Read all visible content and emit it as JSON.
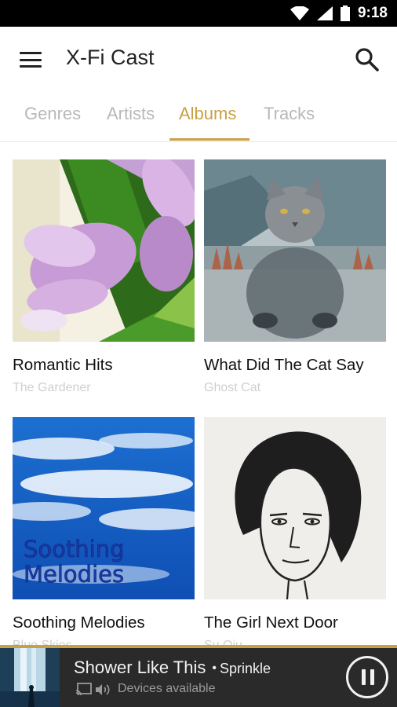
{
  "status_bar": {
    "time": "9:18"
  },
  "app_bar": {
    "title": "X-Fi Cast"
  },
  "tabs": [
    {
      "label": "Genres",
      "active": false
    },
    {
      "label": "Artists",
      "active": false
    },
    {
      "label": "Albums",
      "active": true
    },
    {
      "label": "Tracks",
      "active": false
    }
  ],
  "albums": [
    {
      "title": "Romantic Hits",
      "artist": "The Gardener",
      "cover_icon": "flower-cover"
    },
    {
      "title": "What Did The Cat Say",
      "artist": "Ghost Cat",
      "cover_icon": "cat-cover"
    },
    {
      "title": "Soothing Melodies",
      "artist": "Blue Skies",
      "cover_icon": "sky-cover",
      "cover_text": "Soothing Melodies"
    },
    {
      "title": "The Girl Next Door",
      "artist": "Su Qiu",
      "cover_icon": "sketch-portrait-cover"
    }
  ],
  "now_playing": {
    "track": "Shower Like This",
    "separator": "•",
    "artist": "Sprinkle",
    "devices_text": "Devices available"
  },
  "colors": {
    "accent": "#c9a044",
    "now_playing_bg": "#2a2a2a",
    "inactive_tab": "#b8b8b8"
  }
}
